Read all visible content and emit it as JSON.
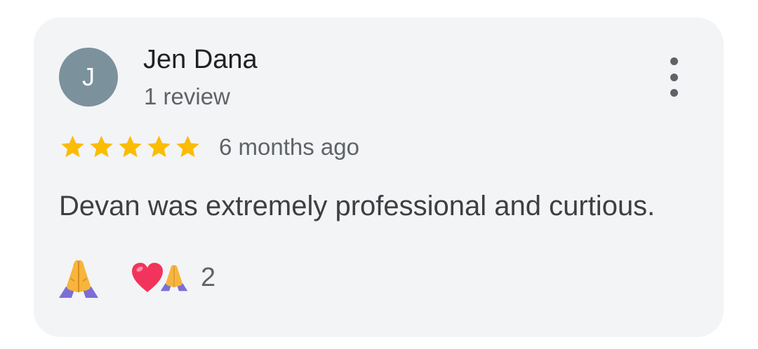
{
  "review": {
    "avatar_initial": "J",
    "reviewer_name": "Jen Dana",
    "review_count": "1 review",
    "rating": 5,
    "rating_max": 5,
    "time_ago": "6 months ago",
    "text": "Devan was extremely professional and curtious.",
    "reactions": {
      "my_reaction_icon": "folded-hands-icon",
      "summary_icons": [
        "heart-icon",
        "folded-hands-icon"
      ],
      "count": "2"
    }
  },
  "colors": {
    "card_bg": "#f3f4f6",
    "avatar_bg": "#7b919c",
    "star": "#fbbc04",
    "name": "#202124",
    "secondary": "#5f6368",
    "body_text": "#3c4043"
  },
  "icons": {
    "more": "more-vertical-icon",
    "star": "star-icon"
  }
}
